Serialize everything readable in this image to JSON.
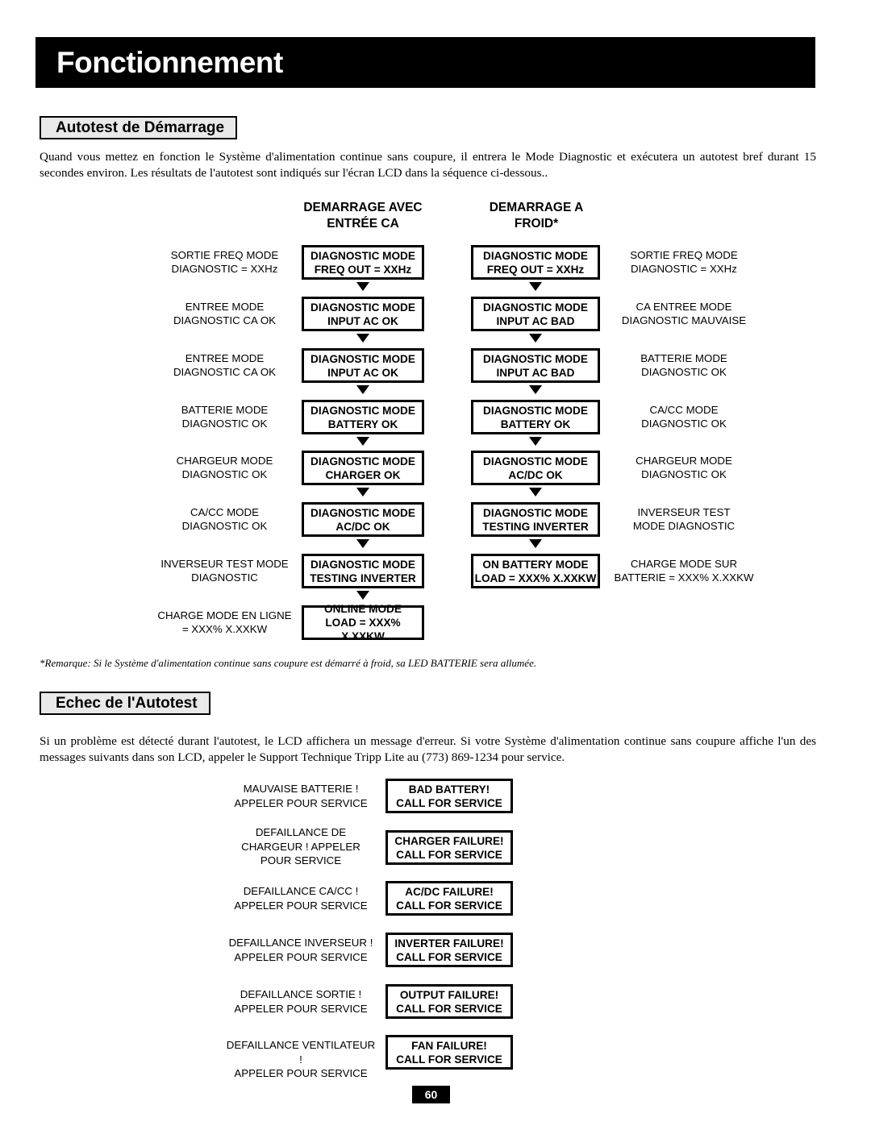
{
  "page": {
    "title": "Fonctionnement",
    "page_number": "60"
  },
  "sections": {
    "autotest": {
      "heading": "Autotest de Démarrage",
      "paragraph": "Quand vous mettez en fonction le Système d'alimentation continue sans coupure, il entrera le Mode Diagnostic et exécutera un autotest bref durant 15 secondes environ. Les résultats de l'autotest sont indiqués sur l'écran LCD dans la séquence ci-dessous..",
      "footnote": "*Remarque: Si le Système d'alimentation continue sans coupure est démarré à froid, sa LED BATTERIE sera allumée."
    },
    "echec": {
      "heading": "Echec de l'Autotest",
      "paragraph": "Si un problème est détecté durant l'autotest, le LCD affichera un message d'erreur. Si votre Système d'alimentation continue sans coupure affiche l'un des messages suivants dans son LCD, appeler le Support Technique Tripp Lite au  (773) 869-1234 pour service."
    }
  },
  "flow": {
    "column_titles": {
      "ac_start": "DEMARRAGE AVEC\nENTRÉE CA",
      "cold_start": "DEMARRAGE A\nFROID*"
    },
    "ac_start_steps": [
      {
        "label": "SORTIE FREQ MODE\nDIAGNOSTIC = XXHz",
        "lcd": "DIAGNOSTIC MODE\nFREQ OUT = XXHz"
      },
      {
        "label": "ENTREE MODE\nDIAGNOSTIC CA OK",
        "lcd": "DIAGNOSTIC MODE\nINPUT AC OK"
      },
      {
        "label": "ENTREE MODE\nDIAGNOSTIC CA OK",
        "lcd": "DIAGNOSTIC MODE\nINPUT AC OK"
      },
      {
        "label": "BATTERIE MODE\nDIAGNOSTIC OK",
        "lcd": "DIAGNOSTIC MODE\nBATTERY OK"
      },
      {
        "label": "CHARGEUR MODE\nDIAGNOSTIC OK",
        "lcd": "DIAGNOSTIC MODE\nCHARGER OK"
      },
      {
        "label": "CA/CC MODE\nDIAGNOSTIC OK",
        "lcd": "DIAGNOSTIC MODE\nAC/DC OK"
      },
      {
        "label": "INVERSEUR TEST MODE\nDIAGNOSTIC",
        "lcd": "DIAGNOSTIC MODE\nTESTING INVERTER"
      },
      {
        "label": "CHARGE MODE EN LIGNE\n= XXX% X.XXKW",
        "lcd": "ONLINE MODE\nLOAD = XXX% X.XXKW"
      }
    ],
    "cold_start_steps": [
      {
        "lcd": "DIAGNOSTIC MODE\nFREQ OUT = XXHz",
        "label": "SORTIE FREQ MODE\nDIAGNOSTIC = XXHz"
      },
      {
        "lcd": "DIAGNOSTIC MODE\nINPUT AC BAD",
        "label": "CA ENTREE MODE\nDIAGNOSTIC MAUVAISE"
      },
      {
        "lcd": "DIAGNOSTIC MODE\nINPUT AC BAD",
        "label": "BATTERIE MODE\nDIAGNOSTIC OK"
      },
      {
        "lcd": "DIAGNOSTIC MODE\nBATTERY OK",
        "label": "CA/CC MODE\nDIAGNOSTIC OK"
      },
      {
        "lcd": "DIAGNOSTIC MODE\nAC/DC OK",
        "label": "CHARGEUR MODE\nDIAGNOSTIC OK"
      },
      {
        "lcd": "DIAGNOSTIC MODE\nTESTING INVERTER",
        "label": "INVERSEUR TEST\nMODE DIAGNOSTIC"
      },
      {
        "lcd": "ON BATTERY MODE\nLOAD = XXX% X.XXKW",
        "label": "CHARGE MODE SUR\nBATTERIE = XXX% X.XXKW"
      }
    ]
  },
  "failures": [
    {
      "label": "MAUVAISE BATTERIE !\nAPPELER POUR SERVICE",
      "lcd": "BAD BATTERY!\nCALL FOR SERVICE"
    },
    {
      "label": "DEFAILLANCE DE\nCHARGEUR ! APPELER\nPOUR SERVICE",
      "lcd": "CHARGER FAILURE!\nCALL FOR SERVICE"
    },
    {
      "label": "DEFAILLANCE CA/CC !\nAPPELER POUR SERVICE",
      "lcd": "AC/DC FAILURE!\nCALL FOR SERVICE"
    },
    {
      "label": "DEFAILLANCE INVERSEUR !\nAPPELER POUR SERVICE",
      "lcd": "INVERTER FAILURE!\nCALL FOR SERVICE"
    },
    {
      "label": "DEFAILLANCE SORTIE !\nAPPELER POUR SERVICE",
      "lcd": "OUTPUT FAILURE!\nCALL FOR SERVICE"
    },
    {
      "label": "DEFAILLANCE VENTILATEUR !\nAPPELER POUR SERVICE",
      "lcd": "FAN FAILURE!\nCALL FOR SERVICE"
    }
  ],
  "colors": {
    "ink": "#000000",
    "heading_fill": "#e9e9e9",
    "paper": "#ffffff"
  }
}
